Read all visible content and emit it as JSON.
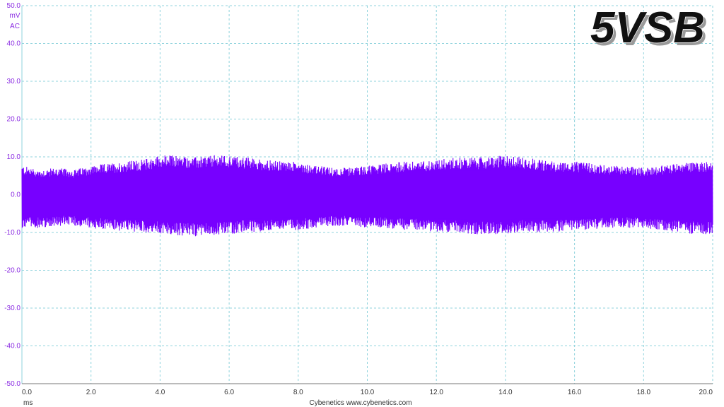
{
  "chart_data": {
    "type": "line",
    "title": "5VSB",
    "ylabel_unit": "mV",
    "ylabel_coupling": "AC",
    "xlabel": "ms",
    "footer": "Cybenetics   www.cybenetics.com",
    "xlim": [
      0,
      20
    ],
    "ylim": [
      -50,
      50
    ],
    "x_ticks": [
      "0.0",
      "2.0",
      "4.0",
      "6.0",
      "8.0",
      "10.0",
      "12.0",
      "14.0",
      "16.0",
      "18.0",
      "20.0"
    ],
    "y_ticks": [
      "50.0",
      "40.0",
      "30.0",
      "20.0",
      "10.0",
      "0.0",
      "-10.0",
      "-20.0",
      "-30.0",
      "-40.0",
      "-50.0"
    ],
    "grid": true,
    "series_color": "#7700ff",
    "series": [
      {
        "envelope_x": [
          0,
          0.5,
          1.0,
          1.5,
          2.0,
          2.5,
          3.0,
          3.5,
          4.0,
          4.5,
          5.0,
          5.5,
          6.0,
          6.5,
          7.0,
          7.5,
          8.0,
          8.5,
          9.0,
          9.5,
          10.0,
          10.5,
          11.0,
          11.5,
          12.0,
          12.5,
          13.0,
          13.5,
          14.0,
          14.5,
          15.0,
          15.5,
          16.0,
          16.5,
          17.0,
          17.5,
          18.0,
          18.5,
          19.0,
          19.5,
          20.0
        ],
        "upper": [
          7,
          6,
          6.5,
          6,
          7,
          7.5,
          8,
          8.5,
          9.5,
          9.5,
          9,
          9.5,
          9.5,
          9,
          8.5,
          8,
          8,
          7,
          6.5,
          6.5,
          7,
          7.5,
          8,
          8,
          8.5,
          9,
          9,
          9,
          9.5,
          9,
          8.5,
          8,
          8,
          7.5,
          7,
          7,
          6.5,
          7,
          7.5,
          8,
          8
        ],
        "lower": [
          -8,
          -8,
          -7.5,
          -7.5,
          -8,
          -8.5,
          -9,
          -9,
          -9.5,
          -10,
          -10,
          -10,
          -9.5,
          -9,
          -9,
          -8.5,
          -8.5,
          -8,
          -7.5,
          -7.5,
          -8,
          -8,
          -8.5,
          -8.5,
          -9,
          -9,
          -9.5,
          -9.5,
          -9.5,
          -9,
          -9,
          -9,
          -8.5,
          -8.5,
          -8,
          -8,
          -8,
          -8.5,
          -9,
          -9.5,
          -9.5
        ]
      }
    ]
  }
}
